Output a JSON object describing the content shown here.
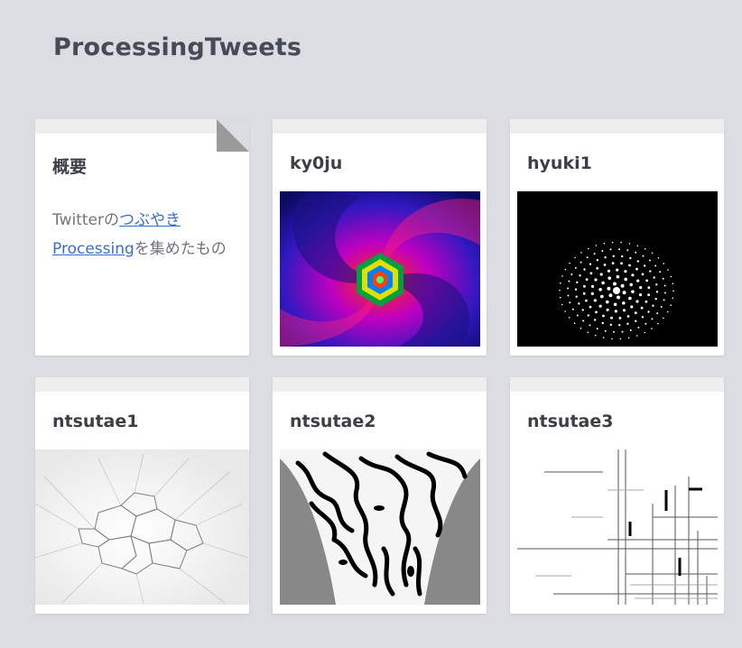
{
  "page": {
    "title": "ProcessingTweets"
  },
  "overview": {
    "title": "概要",
    "desc_prefix": "Twitterの",
    "link1": "つぶやき",
    "link2": "Processing",
    "desc_suffix": "を集めたもの"
  },
  "cards": [
    {
      "title": "ky0ju",
      "thumb_icon": "spiral-hexagon-art"
    },
    {
      "title": "hyuki1",
      "thumb_icon": "dot-pattern-art"
    },
    {
      "title": "ntsutae1",
      "thumb_icon": "voronoi-cells-art"
    },
    {
      "title": "ntsutae2",
      "thumb_icon": "black-white-waves-art"
    },
    {
      "title": "ntsutae3",
      "thumb_icon": "line-glitch-art"
    }
  ],
  "colors": {
    "background": "#dcdde2",
    "link": "#3b6ec9",
    "title": "#454c57"
  }
}
